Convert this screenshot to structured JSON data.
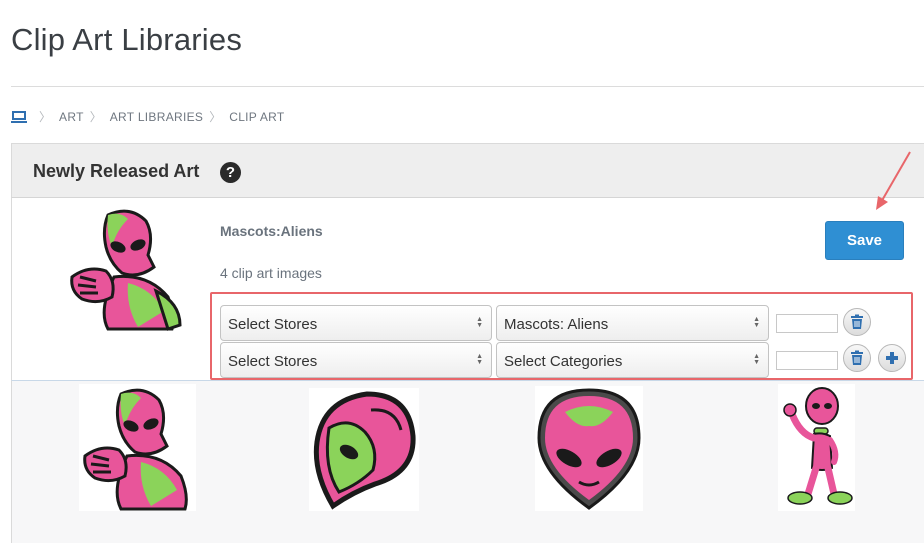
{
  "page": {
    "title": "Clip Art Libraries"
  },
  "breadcrumb": {
    "home_icon": "computer-icon",
    "items": [
      "ART",
      "ART LIBRARIES",
      "CLIP ART"
    ]
  },
  "panel": {
    "title": "Newly Released Art",
    "help_icon": "question-circle-icon",
    "help_glyph": "?"
  },
  "library": {
    "name": "Mascots:Aliens",
    "count_text": "4 clip art images"
  },
  "toolbar": {
    "save_label": "Save",
    "save_color": "#2f8fd3"
  },
  "assignments": [
    {
      "store": "Select Stores",
      "category": "Mascots: Aliens",
      "quantity": "",
      "actions": [
        "trash-icon"
      ]
    },
    {
      "store": "Select Stores",
      "category": "Select Categories",
      "quantity": "",
      "actions": [
        "trash-icon",
        "plus-icon"
      ]
    }
  ],
  "thumbnails": [
    {
      "name": "alien-pointing"
    },
    {
      "name": "alien-head-side"
    },
    {
      "name": "alien-head-front"
    },
    {
      "name": "alien-waving"
    }
  ],
  "colors": {
    "alien_pink": "#e8559a",
    "alien_green": "#8bd35a",
    "highlight": "#e8666a",
    "annotation_arrow": "#e8666a"
  }
}
